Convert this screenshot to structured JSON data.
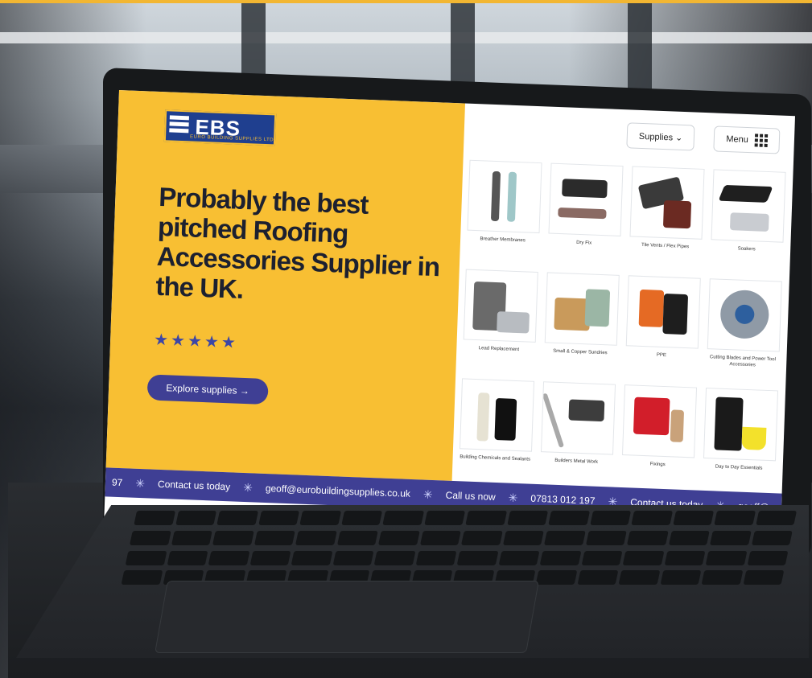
{
  "brand": {
    "logo_text": "EBS",
    "logo_sub": "EURO BUILDING SUPPLIES LTD"
  },
  "nav": {
    "supplies_label": "Supplies ⌄",
    "menu_label": "Menu"
  },
  "hero": {
    "headline": "Probably the best pitched Roofing Accessories Supplier in the UK.",
    "rating_stars": "★★★★★",
    "cta_label": "Explore supplies →"
  },
  "products": [
    {
      "label": "Breather Membranes"
    },
    {
      "label": "Dry Fix"
    },
    {
      "label": "Tile Vents / Flex Pipes"
    },
    {
      "label": "Soakers"
    },
    {
      "label": "Lead Replacement"
    },
    {
      "label": "Small & Copper Sundries"
    },
    {
      "label": "PPE"
    },
    {
      "label": "Cutting Blades and Power Tool Accessories"
    },
    {
      "label": "Building Chemicals and Sealants"
    },
    {
      "label": "Builders Metal Work"
    },
    {
      "label": "Fixings"
    },
    {
      "label": "Day to Day Essentials"
    }
  ],
  "ticker": {
    "lead": "97",
    "items": [
      "Contact us today",
      "geoff@eurobuildingsupplies.co.uk",
      "Call us now",
      "07813 012 197",
      "Contact us today",
      "geoff@eurobuildingsupplies.co.uk"
    ]
  },
  "colors": {
    "hero_bg": "#f8bf33",
    "brand_blue": "#3f3f94",
    "logo_blue": "#1f3f8f"
  }
}
